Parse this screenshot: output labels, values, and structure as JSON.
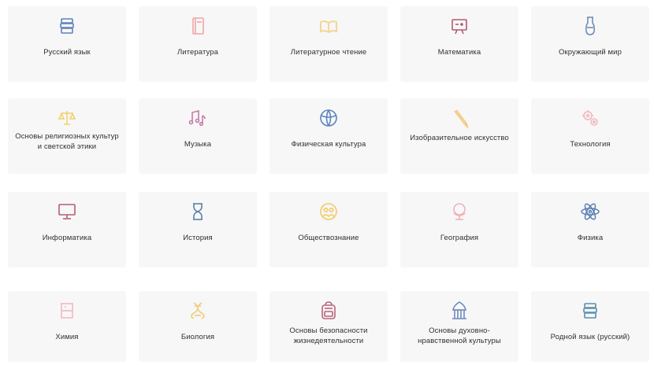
{
  "subjects": [
    {
      "label": "Русский язык",
      "icon": "book-stack-icon",
      "color": "#5b82b8"
    },
    {
      "label": "Литература",
      "icon": "book-icon",
      "color": "#f2a3a8"
    },
    {
      "label": "Литературное чтение",
      "icon": "open-book-icon",
      "color": "#f3d48a"
    },
    {
      "label": "Математика",
      "icon": "board-icon",
      "color": "#b45a6e"
    },
    {
      "label": "Окружающий мир",
      "icon": "flask-icon",
      "color": "#6d8fb8"
    },
    {
      "label": "Основы религиозных культур и светской этики",
      "icon": "scales-icon",
      "color": "#f0d26f"
    },
    {
      "label": "Музыка",
      "icon": "music-notes-icon",
      "color": "#c77ca8"
    },
    {
      "label": "Физическая культура",
      "icon": "globe-icon",
      "color": "#5c84bf"
    },
    {
      "label": "Изобразительное искусство",
      "icon": "pencil-icon",
      "color": "#f1c779"
    },
    {
      "label": "Технология",
      "icon": "gears-icon",
      "color": "#f3b8bf"
    },
    {
      "label": "Информатика",
      "icon": "monitor-icon",
      "color": "#b4606e"
    },
    {
      "label": "История",
      "icon": "hourglass-icon",
      "color": "#5f7fa8"
    },
    {
      "label": "Обществознание",
      "icon": "people-icon",
      "color": "#f2cf73"
    },
    {
      "label": "География",
      "icon": "globe-stand-icon",
      "color": "#f2b0b6"
    },
    {
      "label": "Физика",
      "icon": "atom-icon",
      "color": "#5b7fb2"
    },
    {
      "label": "Химия",
      "icon": "beaker-icon",
      "color": "#f4b7be"
    },
    {
      "label": "Биология",
      "icon": "dna-icon",
      "color": "#f1cf80"
    },
    {
      "label": "Основы безопасности жизнедеятельности",
      "icon": "backpack-icon",
      "color": "#b86478"
    },
    {
      "label": "Основы духовно-нравственной культуры",
      "icon": "temple-icon",
      "color": "#6484b8"
    },
    {
      "label": "Родной язык (русский)",
      "icon": "book-stack-icon",
      "color": "#5b8fae"
    }
  ]
}
